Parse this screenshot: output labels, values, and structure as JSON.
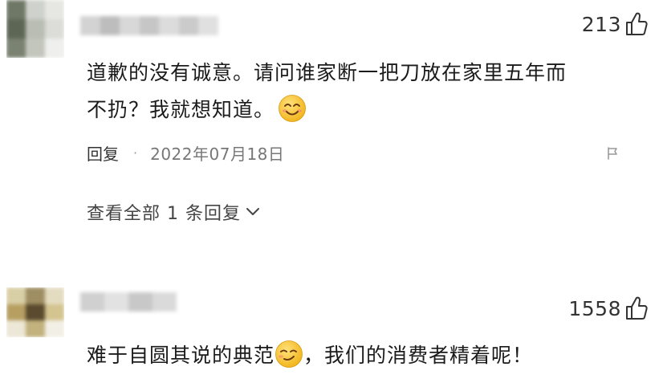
{
  "comments": [
    {
      "likes": "213",
      "text_line1": "道歉的没有诚意。请问谁家断一把刀放在家里五年而",
      "text_line2": "不扔？我就想知道。",
      "reply_label": "回复",
      "date": "2022年07月18日",
      "view_all_label": "查看全部 1 条回复"
    },
    {
      "likes": "1558",
      "text_before": "难于自圆其说的典范",
      "text_after": "，我们的消费者精着呢！"
    }
  ],
  "icons": {
    "like": "thumbs-up-icon",
    "smile": "smiling-face-emoji",
    "smirk": "smirking-face-emoji",
    "more": "report-flag-icon",
    "expand": "chevron-down-icon"
  },
  "colors": {
    "text": "#1b1b1b",
    "meta": "#777777",
    "emoji_yellow": "#f7c531"
  }
}
